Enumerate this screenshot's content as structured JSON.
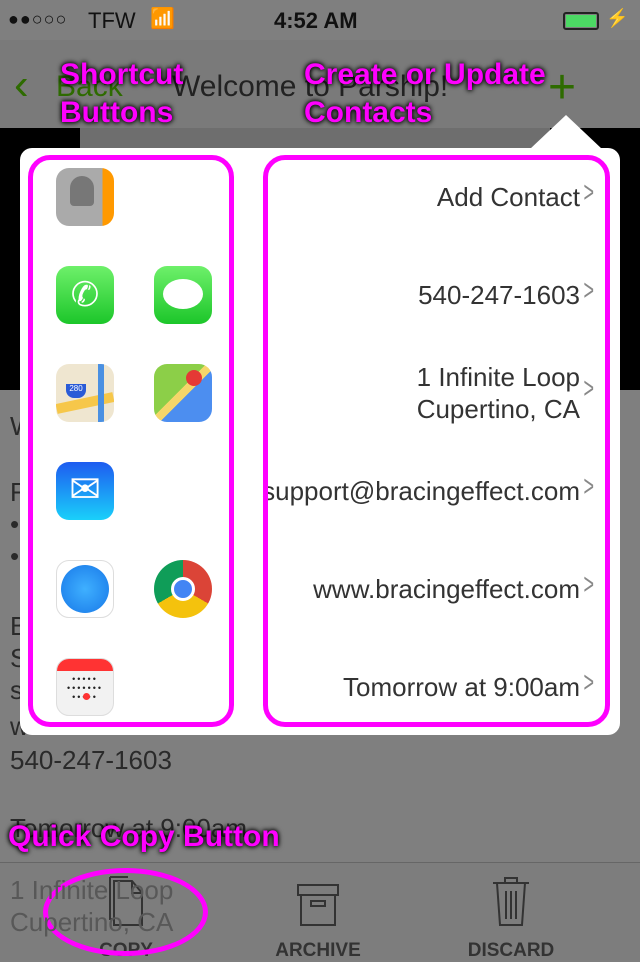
{
  "status_bar": {
    "carrier": "TFW",
    "time": "4:52 AM",
    "signal": "2 of 5",
    "battery": "charging"
  },
  "nav": {
    "back_label": "Back",
    "title": "Welcome to Parship!",
    "add_icon": "plus-icon"
  },
  "background_text": {
    "line_w": "W",
    "line_f": "F",
    "bullet": "•",
    "line_b": "B",
    "line_s": "S",
    "line_s2": "s",
    "line_w2": "w",
    "phone": "540-247-1603",
    "time": "Tomorrow at 9:00am",
    "address1": "1 Infinite Loop",
    "address2": "Cupertino, CA"
  },
  "shortcuts": [
    "contacts-icon",
    "phone-icon",
    "messages-icon",
    "apple-maps-icon",
    "google-maps-icon",
    "mail-icon",
    "safari-icon",
    "chrome-icon",
    "calendar-icon"
  ],
  "contact_rows": [
    {
      "label": "Add Contact"
    },
    {
      "label": "540-247-1603"
    },
    {
      "label": "1 Infinite Loop",
      "label2": "Cupertino, CA"
    },
    {
      "label": "support@bracingeffect.com"
    },
    {
      "label": "www.bracingeffect.com"
    },
    {
      "label": "Tomorrow at 9:00am"
    }
  ],
  "toolbar": {
    "copy": "COPY",
    "archive": "ARCHIVE",
    "discard": "DISCARD"
  },
  "annotations": {
    "shortcut": "Shortcut Buttons",
    "create": "Create or Update Contacts",
    "copy": "Quick Copy Button"
  },
  "colors": {
    "annotation": "#ff00ff",
    "accent": "#2e7d00",
    "battery": "#4cd964"
  }
}
